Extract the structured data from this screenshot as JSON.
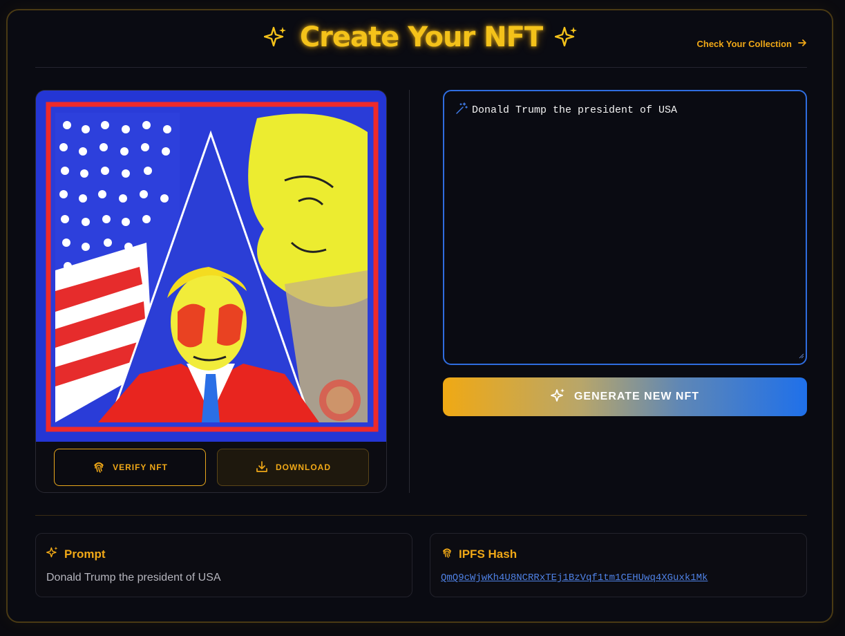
{
  "header": {
    "title": "Create Your NFT",
    "collection_link": "Check Your Collection"
  },
  "image_actions": {
    "verify_label": "VERIFY NFT",
    "download_label": "DOWNLOAD"
  },
  "prompt_input": {
    "value": "Donald Trump the president of USA"
  },
  "generate_button": {
    "label": "GENERATE NEW NFT"
  },
  "prompt_info": {
    "title": "Prompt",
    "value": "Donald Trump the president of USA"
  },
  "ipfs_info": {
    "title": "IPFS Hash",
    "value": "QmQ9cWjwKh4U8NCRRxTEj1BzVqf1tm1CEHUwq4XGuxk1Mk"
  },
  "colors": {
    "accent": "#f0a817",
    "title_glow": "#f4c21a",
    "focus_border": "#2f6de0",
    "link": "#4f82e6",
    "gradient_start": "#f0a914",
    "gradient_end": "#1f70ea"
  },
  "icons": [
    "sparkle-icon",
    "arrow-right-icon",
    "fingerprint-icon",
    "download-icon",
    "magic-wand-icon"
  ]
}
